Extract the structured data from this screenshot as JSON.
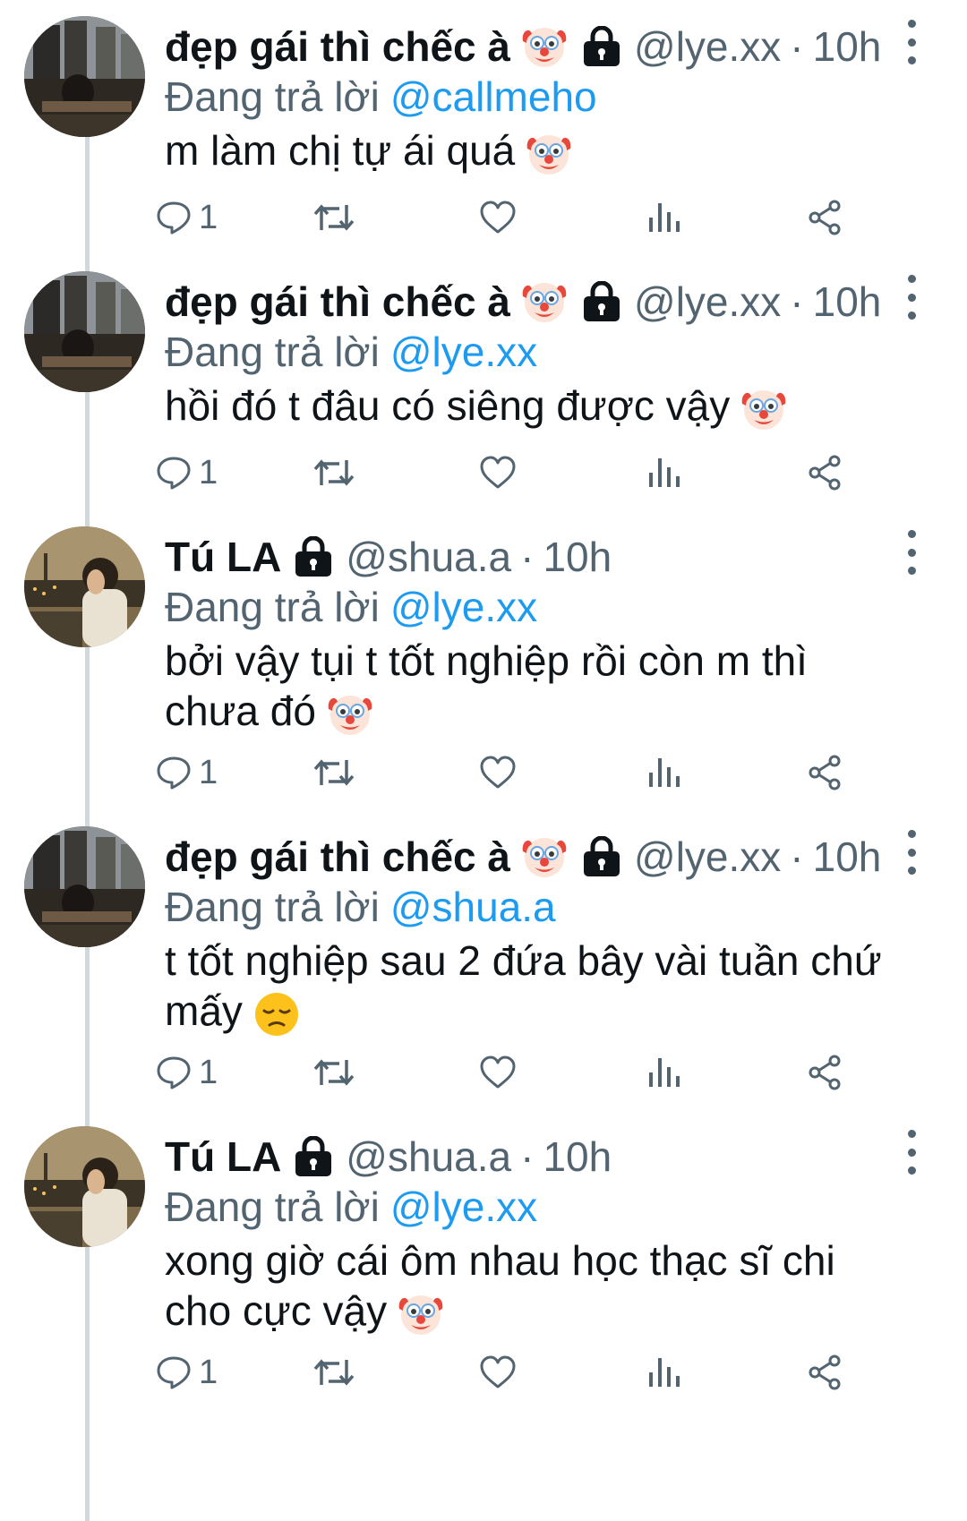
{
  "colors": {
    "text": "#0f1419",
    "secondary": "#536471",
    "link": "#1d9bf0",
    "thread_line": "#cfd9de"
  },
  "tweets": [
    {
      "display_name": "đẹp gái thì chếc à",
      "name_emoji": "clown-face-icon",
      "locked": true,
      "handle": "@lye.xx",
      "separator": "·",
      "time": "10h",
      "reply_label": "Đang trả lời",
      "reply_to": "@callmeho",
      "text": "m làm chị tự ái quá",
      "text_emoji": "clown-face-icon",
      "reply_count": "1"
    },
    {
      "display_name": "đẹp gái thì chếc à",
      "name_emoji": "clown-face-icon",
      "locked": true,
      "handle": "@lye.xx",
      "separator": "·",
      "time": "10h",
      "reply_label": "Đang trả lời",
      "reply_to": "@lye.xx",
      "text": "hồi đó t đâu có siêng được vậy",
      "text_emoji": "clown-face-icon",
      "reply_count": "1"
    },
    {
      "display_name": "Tú LA",
      "locked": true,
      "handle": "@shua.a",
      "separator": "·",
      "time": "10h",
      "reply_label": "Đang trả lời",
      "reply_to": "@lye.xx",
      "text": "bởi vậy tụi t tốt nghiệp rồi còn m thì chưa đó",
      "text_emoji": "clown-face-icon",
      "reply_count": "1"
    },
    {
      "display_name": "đẹp gái thì chếc à",
      "name_emoji": "clown-face-icon",
      "locked": true,
      "handle": "@lye.xx",
      "separator": "·",
      "time": "10h",
      "reply_label": "Đang trả lời",
      "reply_to": "@shua.a",
      "text": "t tốt nghiệp sau 2 đứa bây vài tuần chứ mấy",
      "text_emoji": "disappointed-face-icon",
      "reply_count": "1"
    },
    {
      "display_name": "Tú LA",
      "locked": true,
      "handle": "@shua.a",
      "separator": "·",
      "time": "10h",
      "reply_label": "Đang trả lời",
      "reply_to": "@lye.xx",
      "text": "xong giờ cái ôm nhau học thạc sĩ chi cho cực vậy",
      "text_emoji": "clown-face-icon",
      "reply_count": "1"
    }
  ]
}
